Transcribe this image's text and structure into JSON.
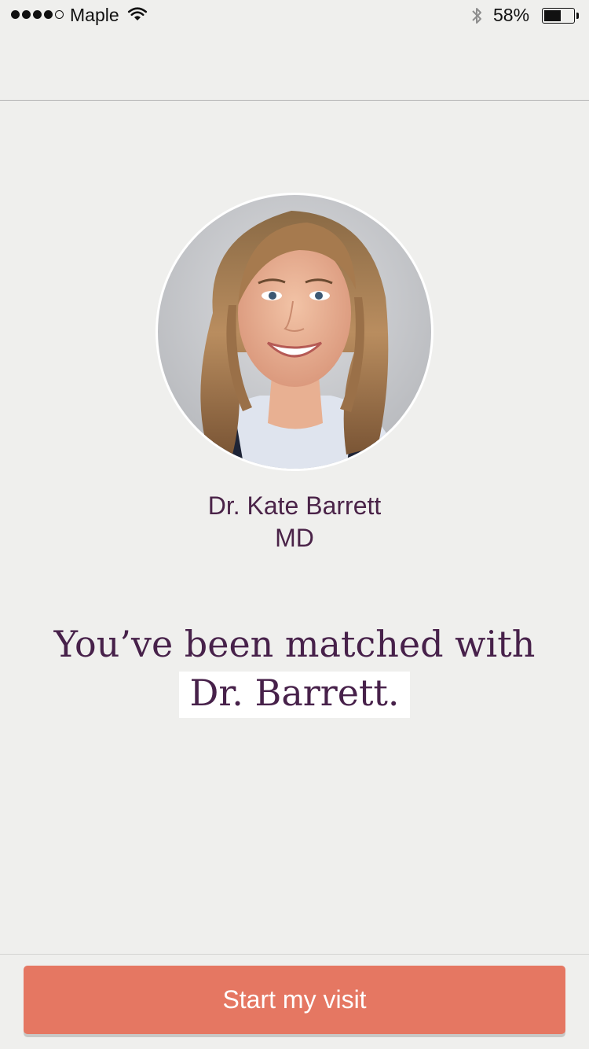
{
  "status_bar": {
    "carrier": "Maple",
    "battery_percent_text": "58%",
    "battery_level": 0.58,
    "icons": [
      "signal-dots",
      "wifi-icon",
      "bluetooth-icon",
      "battery-icon"
    ]
  },
  "doctor": {
    "name": "Dr. Kate Barrett",
    "credential": "MD",
    "photo_description": "circular portrait photo"
  },
  "match": {
    "line1": "You’ve been matched with",
    "line2": "Dr. Barrett."
  },
  "cta": {
    "label": "Start my visit"
  },
  "colors": {
    "background": "#efefed",
    "brand_text": "#4a2348",
    "button": "#e57762",
    "button_text": "#ffffff"
  }
}
